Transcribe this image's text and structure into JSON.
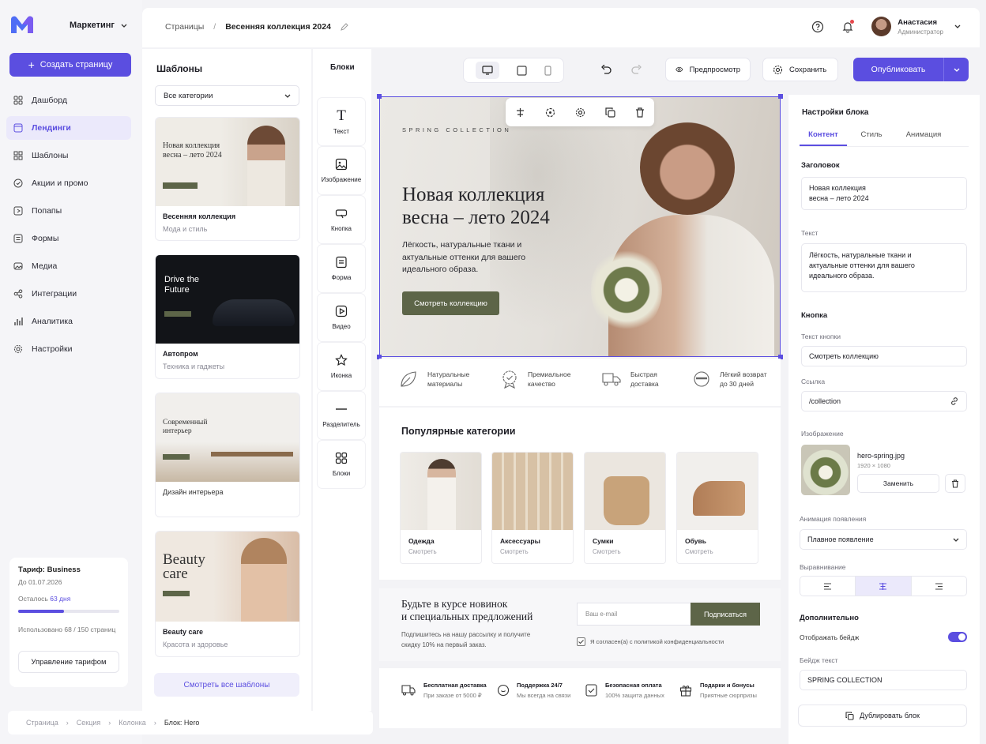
{
  "workspace": "Маркетинг",
  "create_page": "Создать страницу",
  "nav": [
    {
      "label": "Дашборд",
      "icon": "grid-icon"
    },
    {
      "label": "Лендинги",
      "icon": "landing-icon",
      "active": true
    },
    {
      "label": "Шаблоны",
      "icon": "templates-icon"
    },
    {
      "label": "Акции и промо",
      "icon": "tag-icon"
    },
    {
      "label": "Попапы",
      "icon": "popup-icon"
    },
    {
      "label": "Формы",
      "icon": "form-icon"
    },
    {
      "label": "Медиа",
      "icon": "media-icon"
    },
    {
      "label": "Интеграции",
      "icon": "share-icon"
    },
    {
      "label": "Аналитика",
      "icon": "analytics-icon"
    },
    {
      "label": "Настройки",
      "icon": "gear-icon"
    }
  ],
  "plan": {
    "title": "Тариф: Business",
    "until": "До 01.07.2026",
    "remaining_prefix": "Осталось",
    "remaining_value": "63 дня",
    "usage_prefix": "Использовано",
    "usage_value": "68 / 150 страниц",
    "usage_fraction": 0.45,
    "manage": "Управление тарифом"
  },
  "breadcrumb": {
    "root": "Страницы",
    "sep": "/",
    "current": "Весенняя коллекция 2024"
  },
  "user": {
    "name": "Анастасия",
    "role": "Администратор"
  },
  "templates": {
    "title": "Шаблоны",
    "filter": "Все категории",
    "items": [
      {
        "name": "Весенняя коллекция",
        "category": "Мода и стиль",
        "thumb_text": "Новая коллекция весна – лето 2024"
      },
      {
        "name": "Автопром",
        "category": "Техника и гаджеты",
        "thumb_text": "Drive the Future"
      },
      {
        "name": "",
        "category": "Дизайн интерьера",
        "thumb_text": "Современный интерьер"
      },
      {
        "name": "Beauty care",
        "category": "Красота и здоровье",
        "thumb_text": "Beauty care"
      }
    ],
    "view_all": "Смотреть все шаблоны"
  },
  "blocks": {
    "title": "Блоки",
    "items": [
      "Текст",
      "Изображение",
      "Кнопка",
      "Форма",
      "Видео",
      "Иконка",
      "Разделитель",
      "Блоки"
    ]
  },
  "toolbar": {
    "preview": "Предпросмотр",
    "save": "Сохранить",
    "publish": "Опубликовать"
  },
  "hero": {
    "badge": "SPRING COLLECTION",
    "title_line1": "Новая коллекция",
    "title_line2": "весна – лето 2024",
    "text": "Лёгкость, натуральные ткани и актуальные оттенки для вашего идеального образа.",
    "button": "Смотреть коллекцию"
  },
  "features": [
    {
      "line1": "Натуральные",
      "line2": "материалы"
    },
    {
      "line1": "Премиальное",
      "line2": "качество"
    },
    {
      "line1": "Быстрая",
      "line2": "доставка"
    },
    {
      "line1": "Лёгкий возврат",
      "line2": "до 30 дней"
    }
  ],
  "categories": {
    "title": "Популярные категории",
    "items": [
      {
        "name": "Одежда",
        "link": "Смотреть"
      },
      {
        "name": "Аксессуары",
        "link": "Смотреть"
      },
      {
        "name": "Сумки",
        "link": "Смотреть"
      },
      {
        "name": "Обувь",
        "link": "Смотреть"
      }
    ]
  },
  "newsletter": {
    "title_line1": "Будьте в курсе новинок",
    "title_line2": "и специальных предложений",
    "text": "Подпишитесь на нашу рассылку и получите скидку 10% на первый заказ.",
    "placeholder": "Ваш e-mail",
    "button": "Подписаться",
    "consent": "Я согласен(а) с политикой конфиденциальности"
  },
  "benefits": [
    {
      "title": "Бесплатная доставка",
      "sub": "При заказе от 5000 ₽"
    },
    {
      "title": "Поддержка 24/7",
      "sub": "Мы всегда на связи"
    },
    {
      "title": "Безопасная оплата",
      "sub": "100% защита данных"
    },
    {
      "title": "Подарки и бонусы",
      "sub": "Приятные сюрпризы"
    }
  ],
  "props": {
    "title": "Настройки блока",
    "tabs": [
      "Контент",
      "Стиль",
      "Анимация"
    ],
    "heading_label": "Заголовок",
    "heading_value_line1": "Новая коллекция",
    "heading_value_line2": "весна – лето 2024",
    "text_label": "Текст",
    "text_value": "Лёгкость, натуральные ткани и актуальные оттенки для вашего идеального образа.",
    "button_section": "Кнопка",
    "button_text_label": "Текст кнопки",
    "button_text_value": "Смотреть коллекцию",
    "link_label": "Ссылка",
    "link_value": "/collection",
    "image_label": "Изображение",
    "image_name": "hero-spring.jpg",
    "image_size": "1920 × 1080",
    "replace": "Заменить",
    "anim_label": "Анимация появления",
    "anim_value": "Плавное появление",
    "align_label": "Выравнивание",
    "extra_label": "Дополнительно",
    "badge_toggle": "Отображать бейдж",
    "badge_text_label": "Бейдж текст",
    "badge_text_value": "SPRING COLLECTION",
    "duplicate": "Дублировать блок"
  },
  "bottom_crumb": [
    "Страница",
    "Секция",
    "Колонка",
    "Блок: Hero"
  ],
  "colors": {
    "accent": "#5b4ee0",
    "olive": "#5d6548"
  }
}
